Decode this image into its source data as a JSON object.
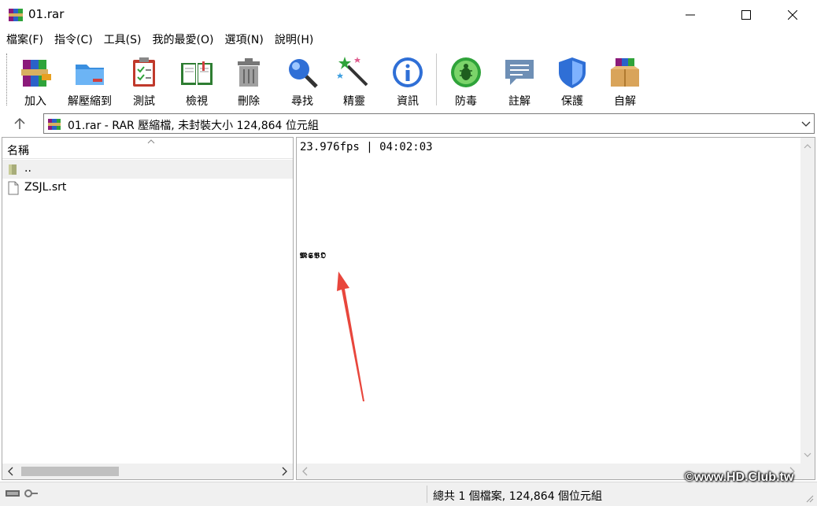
{
  "window": {
    "title": "01.rar"
  },
  "menu": [
    "檔案(F)",
    "指令(C)",
    "工具(S)",
    "我的最愛(O)",
    "選項(N)",
    "說明(H)"
  ],
  "toolbar": {
    "add": "加入",
    "extract": "解壓縮到",
    "test": "測試",
    "view": "檢視",
    "delete": "刪除",
    "find": "尋找",
    "wizard": "精靈",
    "info": "資訊",
    "virus": "防毒",
    "comment": "註解",
    "protect": "保護",
    "sfx": "自解"
  },
  "address": {
    "text": "01.rar - RAR 壓縮檔, 未封裝大小 124,864 位元組"
  },
  "file_list": {
    "column_name": "名稱",
    "items": [
      {
        "name": "..",
        "icon": "folder-up-icon"
      },
      {
        "name": "ZSJL.srt",
        "icon": "file-icon"
      }
    ]
  },
  "preview": {
    "line1": "23.976fps | 04:02:03",
    "line2": "𝕸𝕾𝕭𝕺"
  },
  "status": {
    "text": "總共 1 個檔案, 124,864 個位元組"
  },
  "watermark": "©www.HD.Club.tw",
  "colors": {
    "annotation_arrow": "#e8463c"
  }
}
